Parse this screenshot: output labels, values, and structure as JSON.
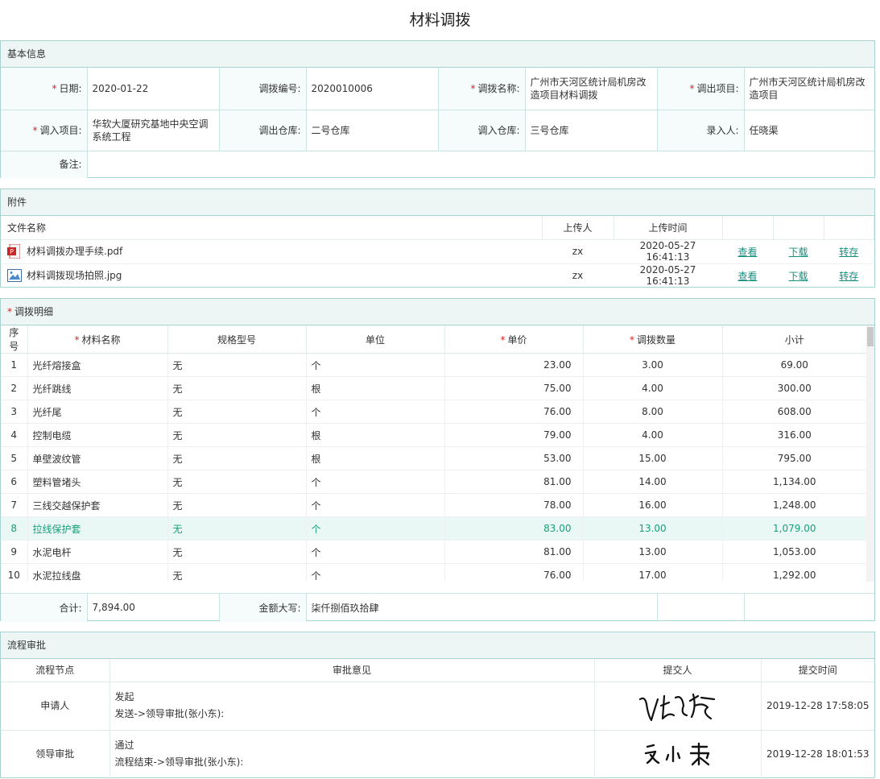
{
  "title": "材料调拨",
  "basic": {
    "header": "基本信息",
    "date_label": "日期:",
    "date": "2020-01-22",
    "no_label": "调拨编号:",
    "no": "2020010006",
    "name_label": "调拨名称:",
    "name": "广州市天河区统计局机房改造项目材料调拨",
    "out_project_label": "调出项目:",
    "out_project": "广州市天河区统计局机房改造项目",
    "in_project_label": "调入项目:",
    "in_project": "华软大厦研究基地中央空调系统工程",
    "out_wh_label": "调出仓库:",
    "out_wh": "二号仓库",
    "in_wh_label": "调入仓库:",
    "in_wh": "三号仓库",
    "recorder_label": "录入人:",
    "recorder": "任晓渠",
    "remark_label": "备注:",
    "remark": ""
  },
  "attachments": {
    "header": "附件",
    "col_name": "文件名称",
    "col_uploader": "上传人",
    "col_time": "上传时间",
    "view_label": "查看",
    "download_label": "下载",
    "transfer_label": "转存",
    "files": [
      {
        "name": "材料调拨办理手续.pdf",
        "icon": "pdf-icon",
        "uploader": "zx",
        "time": "2020-05-27 16:41:13"
      },
      {
        "name": "材料调拨现场拍照.jpg",
        "icon": "image-icon",
        "uploader": "zx",
        "time": "2020-05-27 16:41:13"
      }
    ]
  },
  "detail": {
    "header": "调拨明细",
    "cols": {
      "no": "序号",
      "name": "材料名称",
      "spec": "规格型号",
      "unit": "单位",
      "price": "单价",
      "qty": "调拨数量",
      "subtotal": "小计"
    },
    "rows": [
      {
        "no": "1",
        "name": "光纤熔接盒",
        "spec": "无",
        "unit": "个",
        "price": "23.00",
        "qty": "3.00",
        "subtotal": "69.00"
      },
      {
        "no": "2",
        "name": "光纤跳线",
        "spec": "无",
        "unit": "根",
        "price": "75.00",
        "qty": "4.00",
        "subtotal": "300.00"
      },
      {
        "no": "3",
        "name": "光纤尾",
        "spec": "无",
        "unit": "个",
        "price": "76.00",
        "qty": "8.00",
        "subtotal": "608.00"
      },
      {
        "no": "4",
        "name": "控制电缆",
        "spec": "无",
        "unit": "根",
        "price": "79.00",
        "qty": "4.00",
        "subtotal": "316.00"
      },
      {
        "no": "5",
        "name": "单壁波纹管",
        "spec": "无",
        "unit": "根",
        "price": "53.00",
        "qty": "15.00",
        "subtotal": "795.00"
      },
      {
        "no": "6",
        "name": "塑料管堵头",
        "spec": "无",
        "unit": "个",
        "price": "81.00",
        "qty": "14.00",
        "subtotal": "1,134.00"
      },
      {
        "no": "7",
        "name": "三线交越保护套",
        "spec": "无",
        "unit": "个",
        "price": "78.00",
        "qty": "16.00",
        "subtotal": "1,248.00"
      },
      {
        "no": "8",
        "name": "拉线保护套",
        "spec": "无",
        "unit": "个",
        "price": "83.00",
        "qty": "13.00",
        "subtotal": "1,079.00"
      },
      {
        "no": "9",
        "name": "水泥电杆",
        "spec": "无",
        "unit": "个",
        "price": "81.00",
        "qty": "13.00",
        "subtotal": "1,053.00"
      },
      {
        "no": "10",
        "name": "水泥拉线盘",
        "spec": "无",
        "unit": "个",
        "price": "76.00",
        "qty": "17.00",
        "subtotal": "1,292.00"
      }
    ],
    "total_label": "合计:",
    "total": "7,894.00",
    "amount_cn_label": "金额大写:",
    "amount_cn": "柒仟捌佰玖拾肆"
  },
  "approval": {
    "header": "流程审批",
    "cols": {
      "node": "流程节点",
      "opinion": "审批意见",
      "submitter": "提交人",
      "time": "提交时间"
    },
    "rows": [
      {
        "node": "申请人",
        "opinion": "发起",
        "route": "发送->领导审批(张小东):",
        "signature": "handwritten-signature-1",
        "time": "2019-12-28 17:58:05"
      },
      {
        "node": "领导审批",
        "opinion": "通过",
        "route": "流程结束->领导审批(张小东):",
        "signature": "handwritten-signature-2",
        "time": "2019-12-28 18:01:53"
      }
    ]
  },
  "colors": {
    "accent": "#1a8f7f",
    "border": "#a9d3cf",
    "header_bg": "#edf6f5",
    "required": "#e02020",
    "highlight_row": "#e9f7f5"
  }
}
